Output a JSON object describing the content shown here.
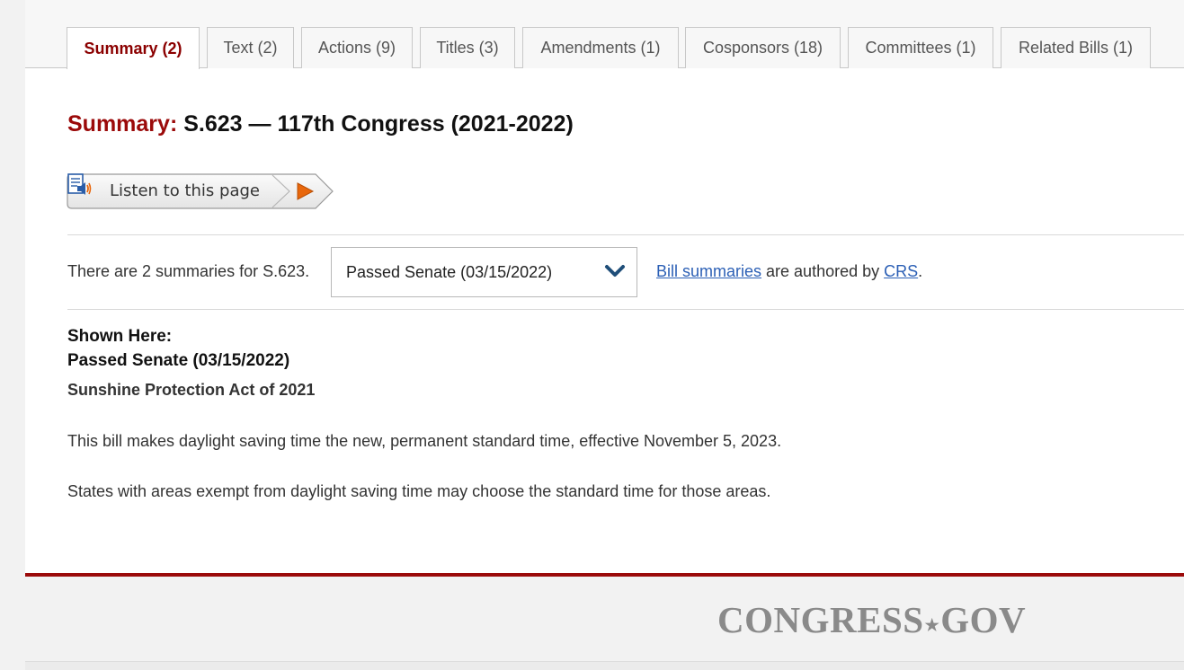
{
  "tabs": [
    {
      "label": "Summary (2)",
      "active": true
    },
    {
      "label": "Text (2)",
      "active": false
    },
    {
      "label": "Actions (9)",
      "active": false
    },
    {
      "label": "Titles (3)",
      "active": false
    },
    {
      "label": "Amendments (1)",
      "active": false
    },
    {
      "label": "Cosponsors (18)",
      "active": false
    },
    {
      "label": "Committees (1)",
      "active": false
    },
    {
      "label": "Related Bills (1)",
      "active": false
    }
  ],
  "title": {
    "prefix": "Summary:",
    "bill": "S.623 — 117th Congress (2021-2022)"
  },
  "listen": {
    "label": "Listen to this page",
    "speaker_icon": "speaker-document-icon",
    "play_icon": "play-icon"
  },
  "summaries": {
    "count_text": "There are 2 summaries for S.623.",
    "selected_version": "Passed Senate (03/15/2022)",
    "dropdown_icon": "chevron-down-icon",
    "author_link": "Bill summaries",
    "author_text": " are authored by ",
    "crs_link": "CRS",
    "author_end": "."
  },
  "content": {
    "shown_here": "Shown Here:",
    "version": "Passed Senate (03/15/2022)",
    "act_title": "Sunshine Protection Act of 2021",
    "paragraphs": [
      "This bill makes daylight saving time the new, permanent standard time, effective November 5, 2023.",
      "States with areas exempt from daylight saving time may choose the standard time for those areas."
    ]
  },
  "footer": {
    "logo_left": "CONGRESS",
    "logo_star": "★",
    "logo_right": "GOV"
  },
  "colors": {
    "accent_red": "#9b0a0a",
    "active_tab_text": "#8b0000",
    "link_blue": "#2b5fb5",
    "chevron_blue": "#1f4e79",
    "play_orange": "#e8670c"
  }
}
